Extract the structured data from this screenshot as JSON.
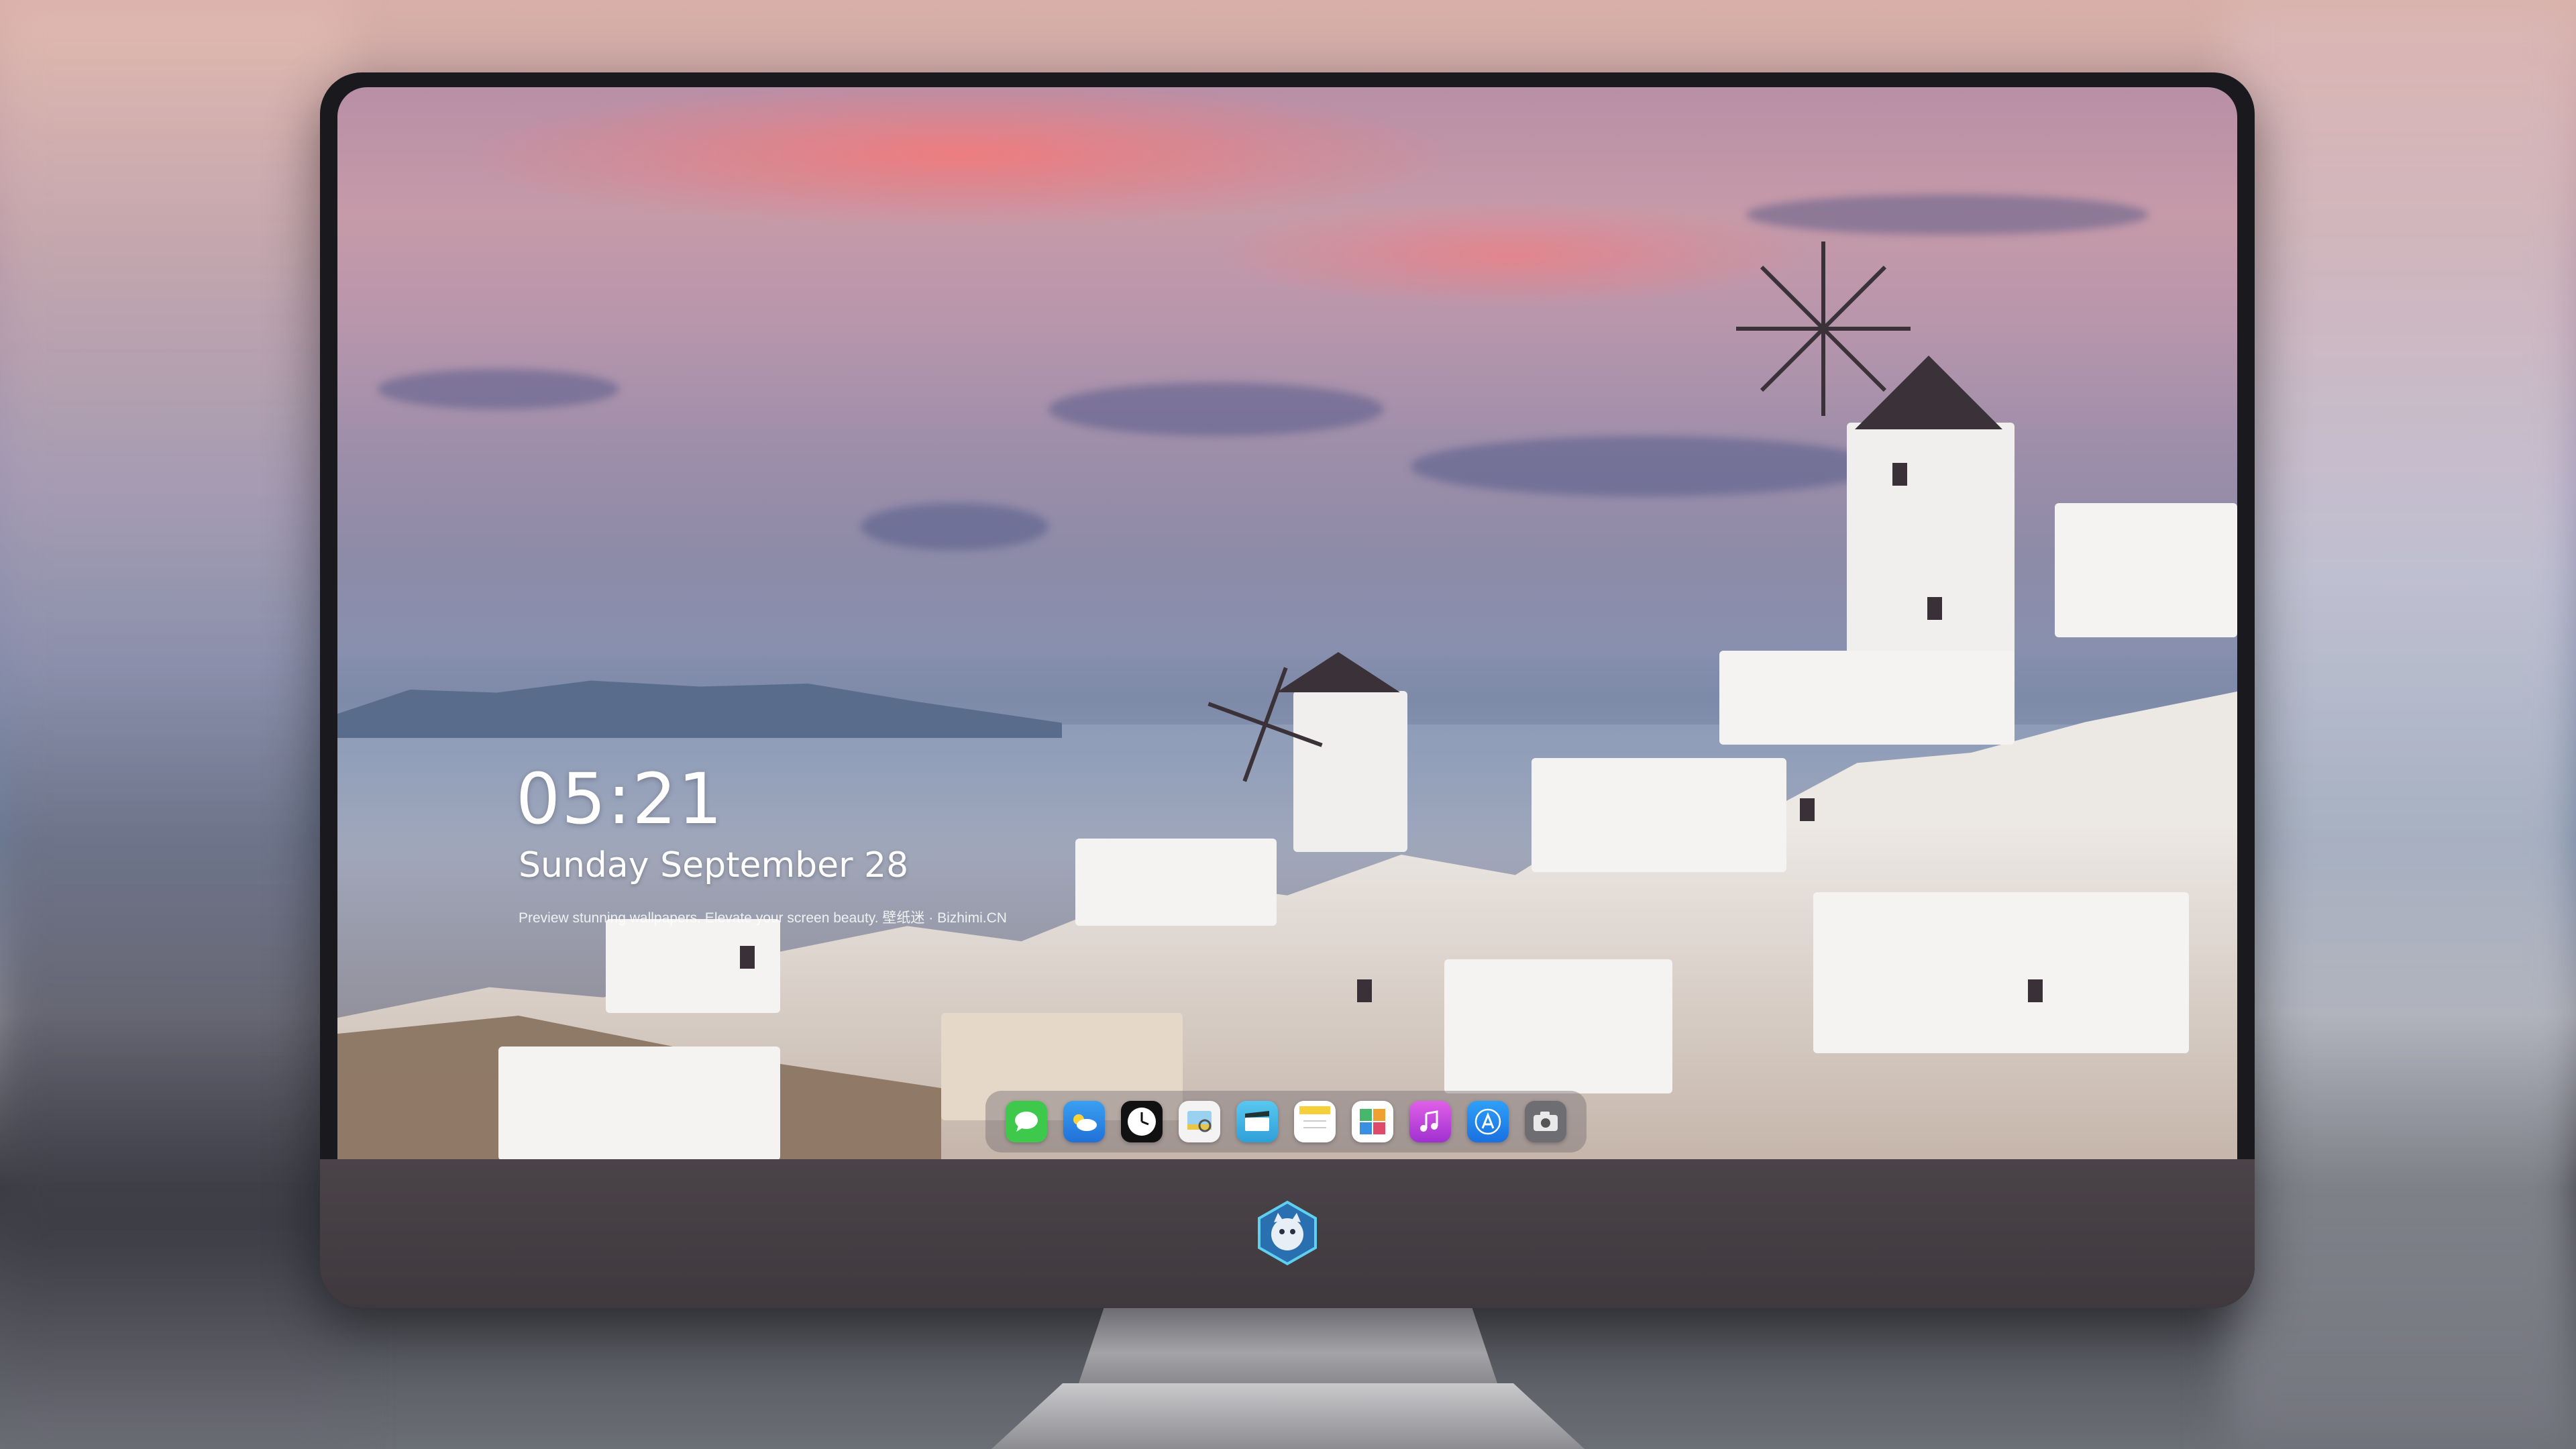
{
  "lockscreen": {
    "time": "05:21",
    "date": "Sunday September  28",
    "caption": "Preview stunning wallpapers. Elevate your screen beauty. 壁纸迷 · Bizhimi.CN"
  },
  "dock": {
    "items": [
      {
        "name": "messages-icon",
        "color": "#3ec94d"
      },
      {
        "name": "weather-icon",
        "color": "#2f8fe8"
      },
      {
        "name": "clock-icon",
        "color": "#111111"
      },
      {
        "name": "preview-icon",
        "color": "#e9c548"
      },
      {
        "name": "clips-icon",
        "color": "#3fb7e8"
      },
      {
        "name": "notes-icon",
        "color": "#f6cf3b"
      },
      {
        "name": "photos-icon",
        "color": "#47b86b"
      },
      {
        "name": "music-icon",
        "color": "#c644e0"
      },
      {
        "name": "app-store-icon",
        "color": "#1f8cf0"
      },
      {
        "name": "camera-icon",
        "color": "#5e5e62"
      }
    ]
  },
  "brand": {
    "logo": "mascot-logo-icon"
  }
}
